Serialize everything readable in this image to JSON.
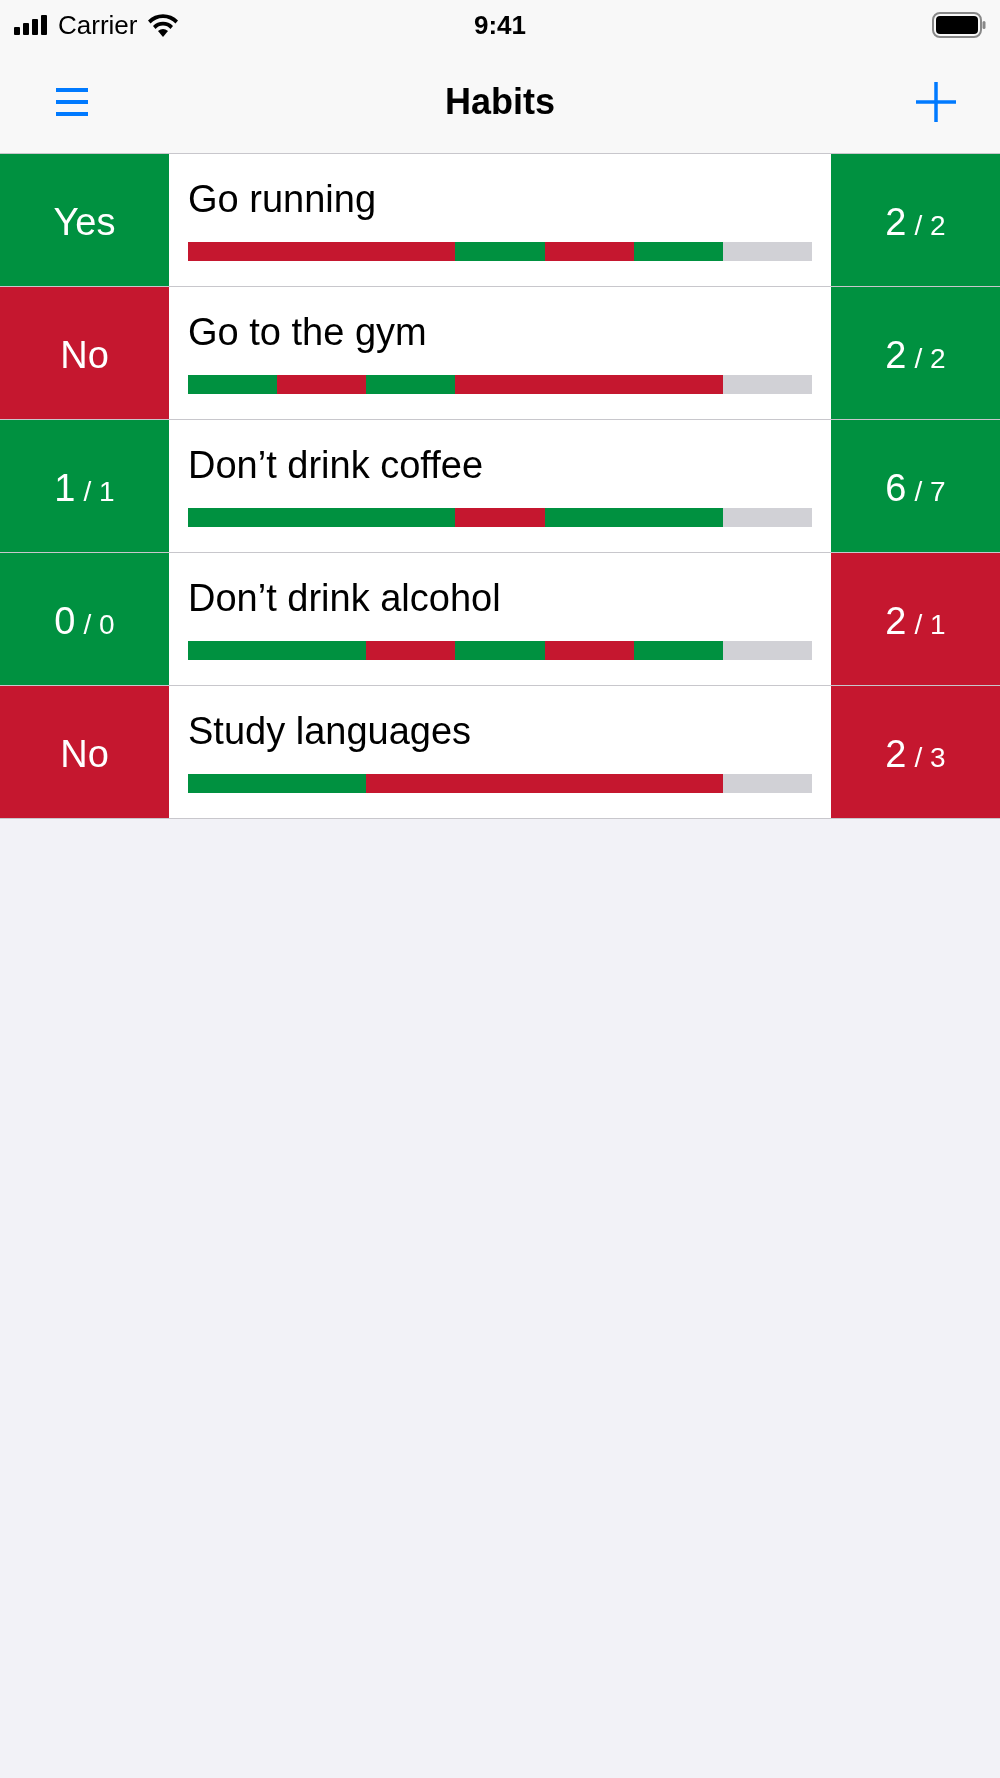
{
  "status_bar": {
    "carrier": "Carrier",
    "time": "9:41"
  },
  "nav": {
    "title": "Habits"
  },
  "habits": [
    {
      "name": "Go running",
      "today": {
        "color": "#009140",
        "value": "Yes"
      },
      "total": {
        "color": "#009140",
        "value": "2",
        "target": "/ 2"
      },
      "days": [
        {
          "color": "#c5172f"
        },
        {
          "color": "#c5172f"
        },
        {
          "color": "#c5172f"
        },
        {
          "color": "#009140"
        },
        {
          "color": "#c5172f"
        },
        {
          "color": "#009140"
        },
        {
          "color": "#d1d1d6"
        }
      ]
    },
    {
      "name": "Go to the gym",
      "today": {
        "color": "#c5172f",
        "value": "No"
      },
      "total": {
        "color": "#009140",
        "value": "2",
        "target": "/ 2"
      },
      "days": [
        {
          "color": "#009140"
        },
        {
          "color": "#c5172f"
        },
        {
          "color": "#009140"
        },
        {
          "color": "#c5172f"
        },
        {
          "color": "#c5172f"
        },
        {
          "color": "#c5172f"
        },
        {
          "color": "#d1d1d6"
        }
      ]
    },
    {
      "name": "Don’t drink coffee",
      "today": {
        "color": "#009140",
        "value": "1",
        "target": "/ 1"
      },
      "total": {
        "color": "#009140",
        "value": "6",
        "target": "/ 7"
      },
      "days": [
        {
          "color": "#009140"
        },
        {
          "color": "#009140"
        },
        {
          "color": "#009140"
        },
        {
          "color": "#c5172f"
        },
        {
          "color": "#009140"
        },
        {
          "color": "#009140"
        },
        {
          "color": "#d1d1d6"
        }
      ]
    },
    {
      "name": "Don’t drink alcohol",
      "today": {
        "color": "#009140",
        "value": "0",
        "target": "/ 0"
      },
      "total": {
        "color": "#c5172f",
        "value": "2",
        "target": "/ 1"
      },
      "days": [
        {
          "color": "#009140"
        },
        {
          "color": "#009140"
        },
        {
          "color": "#c5172f"
        },
        {
          "color": "#009140"
        },
        {
          "color": "#c5172f"
        },
        {
          "color": "#009140"
        },
        {
          "color": "#d1d1d6"
        }
      ]
    },
    {
      "name": "Study languages",
      "today": {
        "color": "#c5172f",
        "value": "No"
      },
      "total": {
        "color": "#c5172f",
        "value": "2",
        "target": "/ 3"
      },
      "days": [
        {
          "color": "#009140"
        },
        {
          "color": "#009140"
        },
        {
          "color": "#c5172f"
        },
        {
          "color": "#c5172f"
        },
        {
          "color": "#c5172f"
        },
        {
          "color": "#c5172f"
        },
        {
          "color": "#d1d1d6"
        }
      ]
    }
  ]
}
